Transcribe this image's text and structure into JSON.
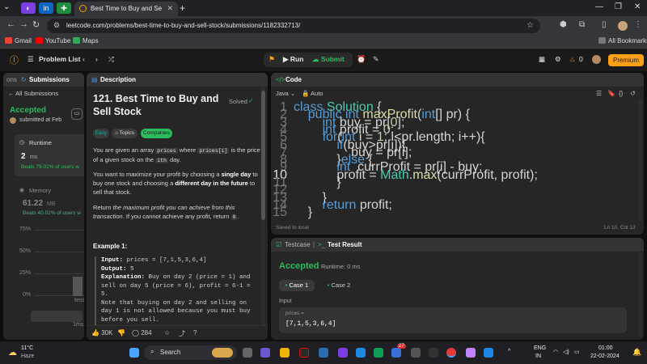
{
  "browser": {
    "tab_title": "Best Time to Buy and Sell Stock",
    "url": "leetcode.com/problems/best-time-to-buy-and-sell-stock/submissions/1182332713/",
    "bookmarks": [
      "Gmail",
      "YouTube",
      "Maps"
    ],
    "all_bookmarks": "All Bookmarks"
  },
  "header": {
    "problem_list": "Problem List",
    "run": "Run",
    "submit": "Submit",
    "streak": "0",
    "premium": "Premium"
  },
  "submissions_panel": {
    "tab_partial": "ons",
    "tab": "Submissions",
    "all": "All Submissions",
    "status": "Accepted",
    "submitted": "submitted at Feb",
    "runtime_label": "Runtime",
    "runtime_value": "2",
    "runtime_unit": "ms",
    "beats_runtime": "Beats 79.01% of users w",
    "memory_label": "Memory",
    "memory_value": "61.22",
    "memory_unit": "MB",
    "beats_memory": "Beats 40.02% of users w",
    "y_ticks": [
      "75%",
      "50%",
      "25%",
      "0%"
    ],
    "x_label_1": "tess",
    "x_label_2": "1ms"
  },
  "description": {
    "tab": "Description",
    "title": "121. Best Time to Buy and Sell Stock",
    "solved": "Solved",
    "difficulty": "Easy",
    "topics": "Topics",
    "companies": "Companies",
    "p1_a": "You are given an array",
    "p1_code1": "prices",
    "p1_b": "where",
    "p1_code2": "prices[i]",
    "p1_c": "is the price of a given stock on the",
    "p1_code3": "ith",
    "p1_d": "day.",
    "p2_a": "You want to maximize your profit by choosing a",
    "p2_b1": "single day",
    "p2_c": "to buy one stock and choosing a",
    "p2_b2": "different day in the future",
    "p2_d": "to sell that stock.",
    "p3_a": "Return",
    "p3_i": "the maximum profit you can achieve from this transaction",
    "p3_b": ". If you cannot achieve any profit, return",
    "p3_code": "0",
    "p3_c": ".",
    "example_title": "Example 1:",
    "ex_input_label": "Input:",
    "ex_input": "prices = [7,1,5,3,6,4]",
    "ex_output_label": "Output:",
    "ex_output": "5",
    "ex_expl_label": "Explanation:",
    "ex_expl_1": "Buy on day 2 (price = 1) and",
    "ex_expl_2": "sell on day 5 (price = 6), profit = 6-1 =",
    "ex_expl_3": "5.",
    "ex_note_1": "Note that buying on day 2 and selling on",
    "ex_note_2": "day 1 is not allowed because you must buy",
    "ex_note_3": "before you sell.",
    "likes": "30K",
    "comments": "284"
  },
  "code_panel": {
    "tab": "Code",
    "language": "Java",
    "auto": "Auto",
    "saved": "Saved to local",
    "cursor": "Ln 10, Col 13",
    "lines": [
      "class Solution {",
      "    public int maxProfit(int[] pr) {",
      "        int buy = pr[0];",
      "        int profit = 0;",
      "        for(int i = 1; i<pr.length; i++){",
      "            if(buy>pr[i]){",
      "                buy = pr[i];",
      "            }else {",
      "            int  currProfit = pr[i] - buy;",
      "            profit = Math.max(currProfit, profit);",
      "            }",
      "",
      "        }",
      "        return profit;",
      "    }"
    ]
  },
  "result_panel": {
    "testcase": "Testcase",
    "test_result": "Test Result",
    "status": "Accepted",
    "runtime": "Runtime: 0 ms",
    "case1": "Case 1",
    "case2": "Case 2",
    "input_label": "Input",
    "var_name": "prices =",
    "var_value": "[7,1,5,3,6,4]"
  },
  "taskbar": {
    "temp": "11°C",
    "weather": "Haze",
    "search": "Search",
    "badge": "27",
    "lang1": "ENG",
    "lang2": "IN",
    "time": "01:00",
    "date": "22-02-2024"
  },
  "colors": {
    "accent_green": "#2cbb5d",
    "accent_orange": "#ffa116",
    "easy": "#00b8a3"
  }
}
